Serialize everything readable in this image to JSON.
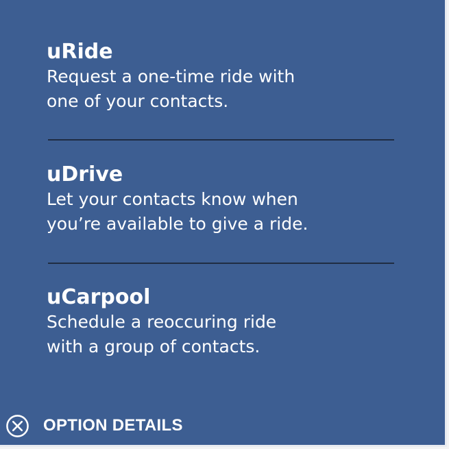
{
  "colors": {
    "card_background": "#3d5e92",
    "text": "#ffffff",
    "divider": "#1f2c42"
  },
  "options": [
    {
      "title": "uRide",
      "description_lines": [
        "Request a one-time ride with",
        "one of your contacts."
      ]
    },
    {
      "title": "uDrive",
      "description_lines": [
        "Let your contacts know when",
        "you’re available to give a ride."
      ]
    },
    {
      "title": "uCarpool",
      "description_lines": [
        "Schedule a reoccuring ride",
        "with a group of contacts."
      ]
    }
  ],
  "footer": {
    "icon": "close-circle-icon",
    "label": "OPTION DETAILS"
  }
}
